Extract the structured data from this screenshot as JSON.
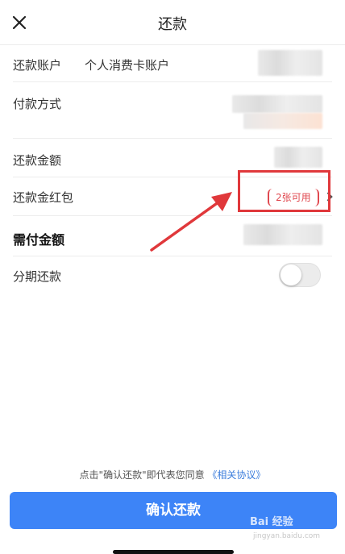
{
  "header": {
    "title": "还款"
  },
  "rows": {
    "account_label": "还款账户",
    "account_value": "个人消费卡账户",
    "payment_method_label": "付款方式",
    "amount_label": "还款金额",
    "coupon_label": "还款金红包",
    "coupon_tag": "2张可用",
    "payable_label": "需付金额",
    "installment_label": "分期还款"
  },
  "installment_toggle": {
    "on": false
  },
  "agreement": {
    "prefix": "点击\"确认还款\"即代表您同意",
    "link": "《相关协议》"
  },
  "confirm_button": {
    "label": "确认还款"
  },
  "watermark": {
    "brand": "Bai 经验",
    "url": "jingyan.baidu.com"
  },
  "colors": {
    "primary": "#3d84f7",
    "annotation_red": "#e0383b",
    "link": "#3b7ddc"
  }
}
